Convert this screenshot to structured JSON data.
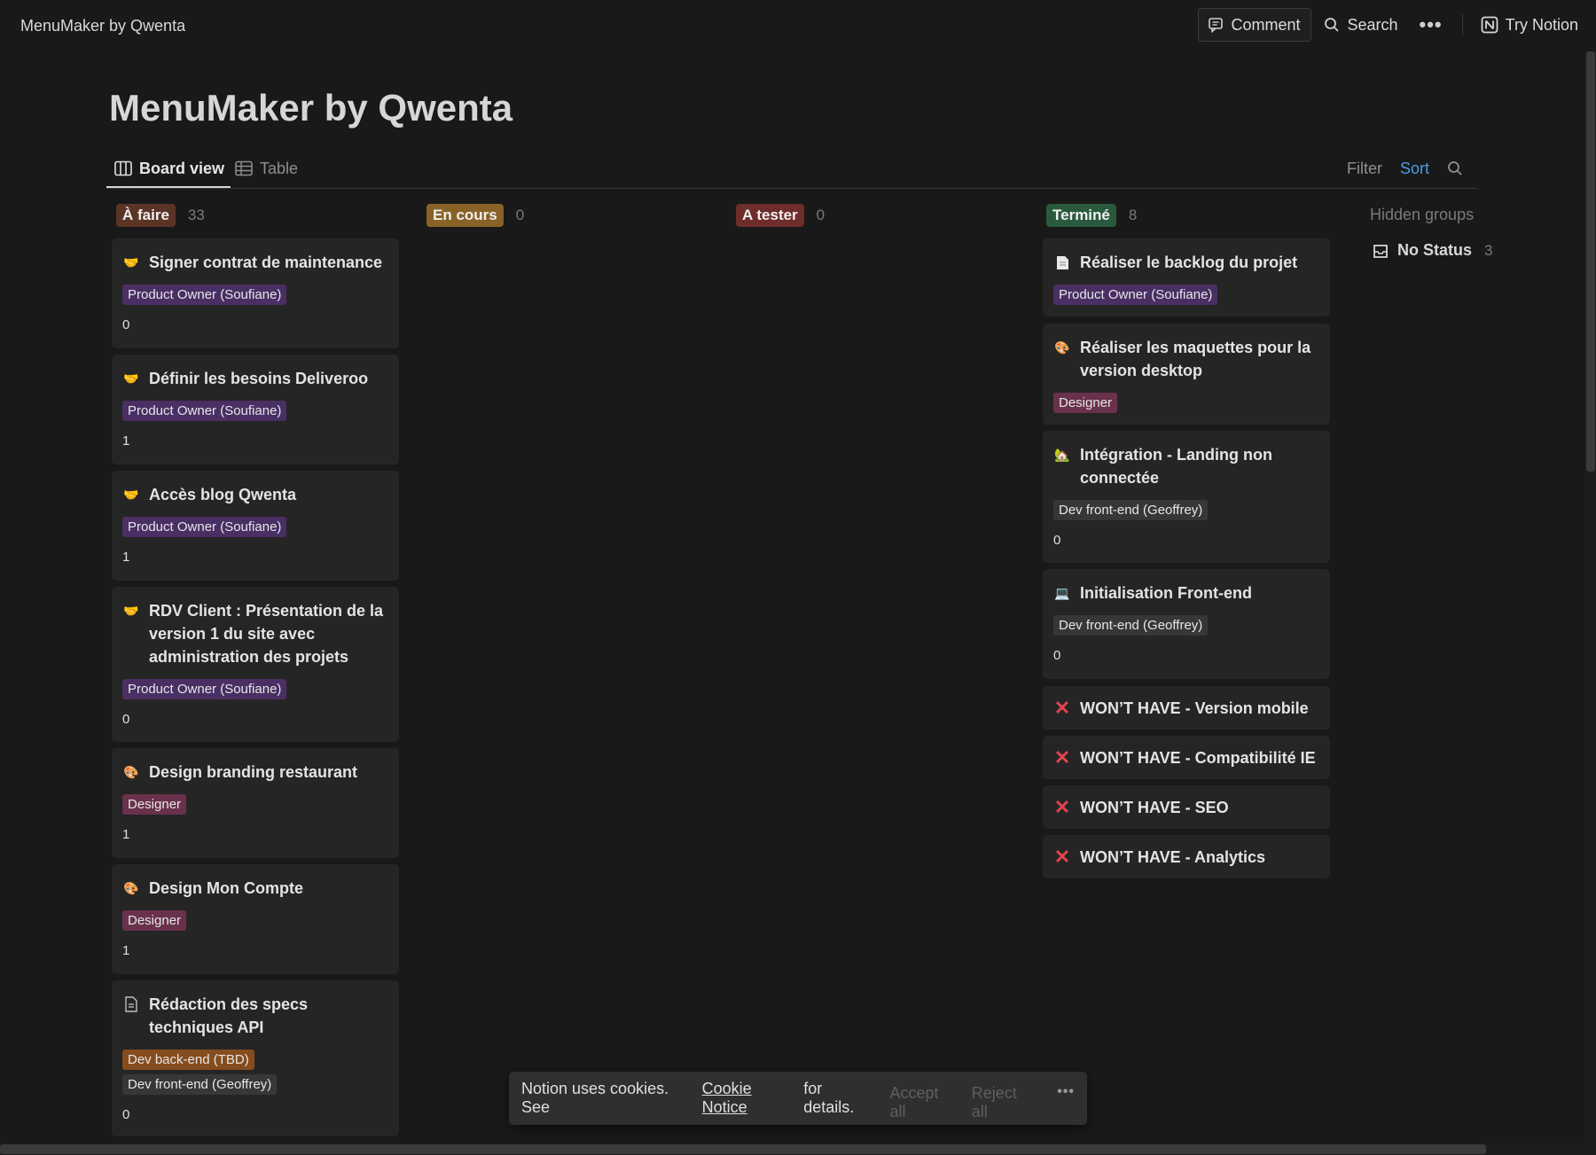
{
  "topbar": {
    "breadcrumb": "MenuMaker by Qwenta",
    "comment_label": "Comment",
    "search_label": "Search",
    "more_label": "•••",
    "try_notion_label": "Try Notion"
  },
  "page": {
    "title": "MenuMaker by Qwenta"
  },
  "views": {
    "board_label": "Board view",
    "table_label": "Table",
    "filter_label": "Filter",
    "sort_label": "Sort"
  },
  "columns": [
    {
      "label": "À faire",
      "count": "33",
      "color": "#5c3426"
    },
    {
      "label": "En cours",
      "count": "0",
      "color": "#896227"
    },
    {
      "label": "A tester",
      "count": "0",
      "color": "#6e2c2a"
    },
    {
      "label": "Terminé",
      "count": "8",
      "color": "#2a5a3d"
    }
  ],
  "todo_cards": [
    {
      "icon": "handshake-icon",
      "title": "Signer contrat de maintenance",
      "tags": [
        "Product Owner (Soufiane)"
      ],
      "value": "0"
    },
    {
      "icon": "handshake-icon",
      "title": "Définir les besoins Deliveroo",
      "tags": [
        "Product Owner (Soufiane)"
      ],
      "value": "1"
    },
    {
      "icon": "handshake-icon",
      "title": "Accès blog Qwenta",
      "tags": [
        "Product Owner (Soufiane)"
      ],
      "value": "1"
    },
    {
      "icon": "handshake-icon",
      "title": "RDV Client : Présentation de la version 1 du site avec administration des projets",
      "tags": [
        "Product Owner (Soufiane)"
      ],
      "value": "0"
    },
    {
      "icon": "palette-icon",
      "title": "Design branding restaurant",
      "tags": [
        "Designer"
      ],
      "value": "1"
    },
    {
      "icon": "palette-icon",
      "title": "Design Mon Compte",
      "tags": [
        "Designer"
      ],
      "value": "1"
    },
    {
      "icon": "document-icon",
      "title": "Rédaction des specs techniques API",
      "tags": [
        "Dev back-end (TBD)",
        "Dev front-end (Geoffrey)"
      ],
      "value": "0"
    }
  ],
  "done_cards": [
    {
      "icon": "page-icon",
      "title": "Réaliser le backlog du projet",
      "tags": [
        "Product Owner (Soufiane)"
      ]
    },
    {
      "icon": "palette-icon",
      "title": "Réaliser les maquettes pour la version desktop",
      "tags": [
        "Designer"
      ]
    },
    {
      "icon": "house-icon",
      "title": "Intégration - Landing non connectée",
      "tags": [
        "Dev front-end (Geoffrey)"
      ],
      "value": "0"
    },
    {
      "icon": "laptop-icon",
      "title": "Initialisation Front-end",
      "tags": [
        "Dev front-end (Geoffrey)"
      ],
      "value": "0"
    },
    {
      "icon": "cross-icon",
      "title": "WON’T HAVE - Version mobile"
    },
    {
      "icon": "cross-icon",
      "title": "WON’T HAVE - Compatibilité IE"
    },
    {
      "icon": "cross-icon",
      "title": "WON’T HAVE - SEO"
    },
    {
      "icon": "cross-icon",
      "title": "WON’T HAVE - Analytics"
    }
  ],
  "hidden_groups": {
    "label": "Hidden groups",
    "no_status_label": "No Status",
    "no_status_count": "3"
  },
  "cookie_banner": {
    "text_before": "Notion uses cookies. See",
    "link_label": "Cookie Notice",
    "text_after": "for details.",
    "accept_label": "Accept all",
    "reject_label": "Reject all",
    "more_label": "•••"
  }
}
